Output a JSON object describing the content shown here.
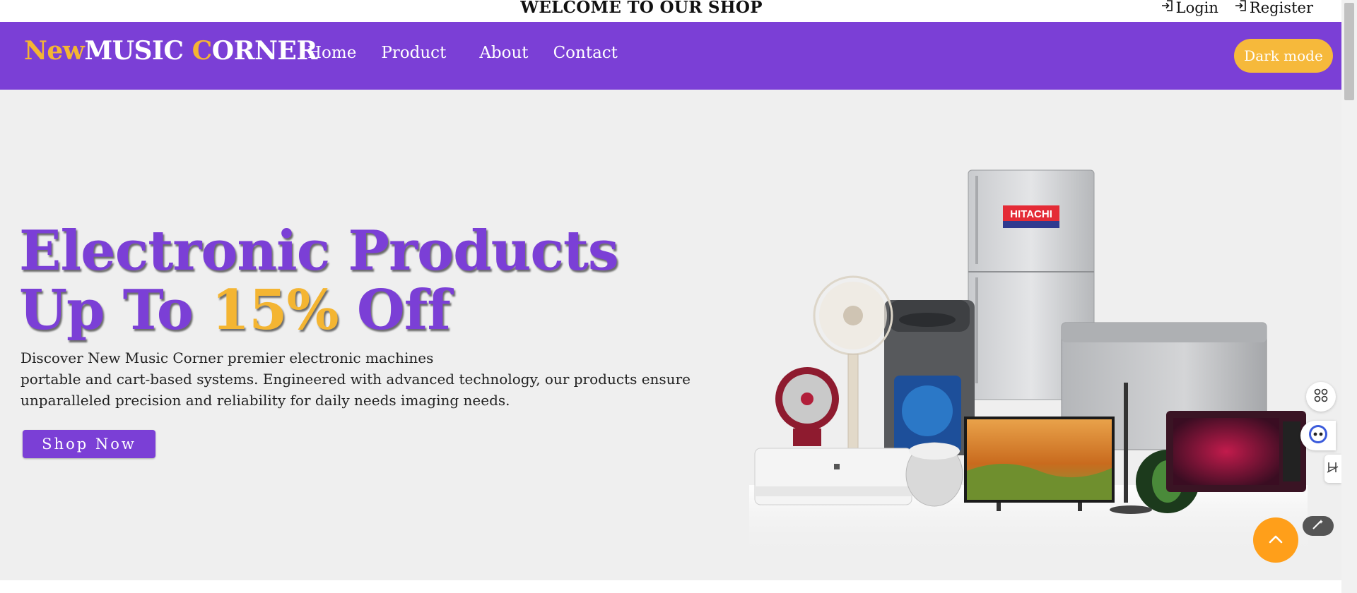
{
  "topbar": {
    "welcome": "WELCOME TO OUR SHOP",
    "login": "Login",
    "register": "Register"
  },
  "brand": {
    "part1": "New",
    "part2": "MUSIC ",
    "part3": "C",
    "part4": "ORNER"
  },
  "nav": {
    "items": [
      {
        "label": "Home"
      },
      {
        "label": "Product"
      },
      {
        "label": "About"
      },
      {
        "label": "Contact"
      }
    ],
    "dark_mode": "Dark mode"
  },
  "hero": {
    "line1": "Electronic Products",
    "line2_a": "Up To ",
    "line2_b": "15%",
    "line2_c": " Off",
    "desc1": "Discover New Music Corner premier electronic machines",
    "desc2": "portable and cart-based systems. Engineered with advanced technology, our products ensure",
    "desc3": "unparalleled precision and reliability for daily needs imaging needs.",
    "cta": "Shop Now",
    "fridge_brand": "HITACHI"
  },
  "colors": {
    "primary": "#7b3fd6",
    "accent": "#f4b532",
    "hero_bg": "#efefef",
    "to_top": "#ff9f1a"
  },
  "icons": {
    "login": "login-icon",
    "register": "register-icon",
    "to_top": "chevron-up-icon",
    "widget1": "grid-icon",
    "widget2": "assistant-icon",
    "widget3": "translate-icon",
    "widget4": "magic-wand-icon"
  }
}
